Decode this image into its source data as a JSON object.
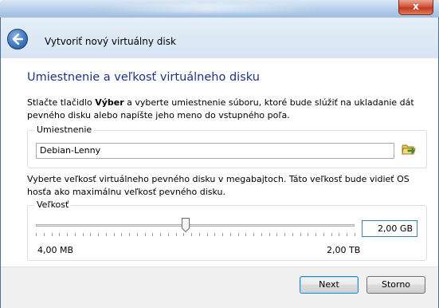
{
  "window": {
    "close_glyph": "x",
    "header_title": "Vytvoriť nový virtuálny disk"
  },
  "page": {
    "title": "Umiestnenie a veľkosť virtuálneho disku",
    "intro_pre": "Stlačte tlačidlo ",
    "intro_bold": "Výber",
    "intro_post": " a vyberte umiestnenie súboru, ktoré bude slúžiť na ukladanie dát pevného disku alebo napíšte jeho meno do vstupného poľa."
  },
  "location": {
    "group_label": "Umiestnenie",
    "value": "Debian-Lenny",
    "icon": "folder-browse-icon"
  },
  "size": {
    "description": "Vyberte veľkosť virtuálneho pevného disku v megabajtoch. Táto veľkosť bude vidieť OS hosťa ako maximálnu veľkosť pevného disku.",
    "group_label": "Veľkosť",
    "value": "2,00 GB",
    "min_label": "4,00 MB",
    "max_label": "2,00 TB",
    "slider_fraction": 0.47
  },
  "buttons": {
    "next": "Next",
    "cancel": "Storno"
  },
  "colors": {
    "title": "#1e3287",
    "accent": "#3c7fb1"
  }
}
